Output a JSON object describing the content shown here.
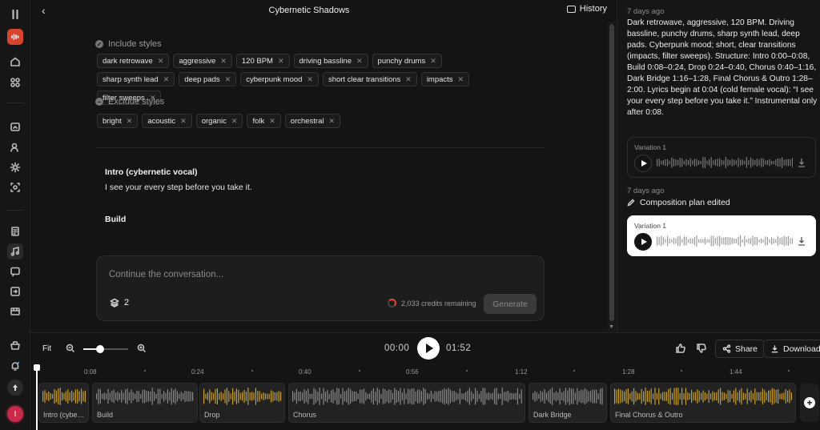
{
  "header": {
    "title": "Cybernetic Shadows",
    "history_label": "History"
  },
  "include": {
    "label": "Include styles",
    "chips": [
      "dark retrowave",
      "aggressive",
      "120 BPM",
      "driving bassline",
      "punchy drums",
      "sharp synth lead",
      "deep pads",
      "cyberpunk mood",
      "short clear transitions",
      "impacts",
      "filter sweeps"
    ]
  },
  "exclude": {
    "label": "Exclude styles",
    "chips": [
      "bright",
      "acoustic",
      "organic",
      "folk",
      "orchestral"
    ]
  },
  "lyrics": {
    "section1_title": "Intro (cybernetic vocal)",
    "section1_text": "I see your every step before you take it.",
    "section2_title": "Build"
  },
  "composer": {
    "placeholder": "Continue the conversation...",
    "count": "2",
    "credits": "2,033 credits remaining",
    "generate_label": "Generate"
  },
  "history": {
    "entry1": {
      "time": "7 days ago",
      "description": "Dark retrowave, aggressive, 120 BPM. Driving bassline, punchy drums, sharp synth lead, deep pads. Cyberpunk mood; short, clear transitions (impacts, filter sweeps). Structure: Intro 0:00–0:08, Build 0:08–0:24, Drop 0:24–0:40, Chorus 0:40–1:16, Dark Bridge 1:16–1:28, Final Chorus & Outro 1:28–2:00. Lyrics begin at 0:04 (cold female vocal): “I see your every step before you take it.” Instrumental only after 0:08.",
      "variation": "Variation 1"
    },
    "entry2": {
      "time": "7 days ago",
      "action": "Composition plan edited",
      "variation": "Variation 1"
    }
  },
  "transport": {
    "fit_label": "Fit",
    "zoom_level": 0.38,
    "current_time": "00:00",
    "total_time": "01:52",
    "share_label": "Share",
    "download_label": "Download"
  },
  "timeline": {
    "ticks": [
      "0:08",
      "0:24",
      "0:40",
      "0:56",
      "1:12",
      "1:28",
      "1:44"
    ],
    "sections": [
      {
        "label": "Intro (cybe…",
        "color": "#c9a227"
      },
      {
        "label": "Build",
        "color": "#8a8a8a"
      },
      {
        "label": "Drop",
        "color": "#c9a227"
      },
      {
        "label": "Chorus",
        "color": "#8a8a8a"
      },
      {
        "label": "Dark Bridge",
        "color": "#8a8a8a"
      },
      {
        "label": "Final Chorus & Outro",
        "color": "#c9a227"
      }
    ]
  },
  "user": {
    "avatar_initial": "I"
  },
  "colors": {
    "accent": "#e2493a",
    "waveform_gold": "#c9a227",
    "brand": "#d9442f"
  }
}
